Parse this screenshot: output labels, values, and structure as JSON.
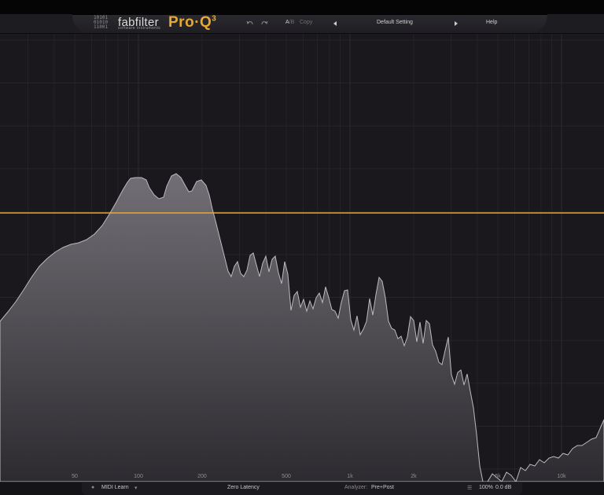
{
  "header": {
    "logo_bits": [
      "10101",
      "01010",
      "11001"
    ],
    "brand_name": "fabfilter",
    "brand_sub": "software instruments",
    "product_name": "Pro",
    "product_dot": "·",
    "product_q": "Q",
    "product_version": "3",
    "undo_icon": "undo-icon",
    "redo_icon": "redo-icon",
    "ab_a": "A",
    "ab_sep": "/",
    "ab_b": "B",
    "copy_label": "Copy",
    "preset_name": "Default Setting",
    "help_label": "Help"
  },
  "spectrum": {
    "freq_ticks": [
      {
        "label": "50",
        "hz": 50
      },
      {
        "label": "100",
        "hz": 100
      },
      {
        "label": "200",
        "hz": 200
      },
      {
        "label": "500",
        "hz": 500
      },
      {
        "label": "1k",
        "hz": 1000
      },
      {
        "label": "2k",
        "hz": 2000
      },
      {
        "label": "5k",
        "hz": 5000
      },
      {
        "label": "10k",
        "hz": 10000
      }
    ],
    "eq_curve_gain_db": 0,
    "colors": {
      "background": "#1a181c",
      "grid": "#2b2a2f",
      "spectrum_fill": "#6b676d",
      "spectrum_stroke": "#bdbabf",
      "eq_curve": "#e8a832"
    }
  },
  "footer": {
    "midi_learn": "MIDI Learn",
    "latency": "Zero Latency",
    "analyzer_label": "Analyzer:",
    "analyzer_value": "Pre+Post",
    "zoom": "100%",
    "output_gain": "0.0 dB"
  }
}
